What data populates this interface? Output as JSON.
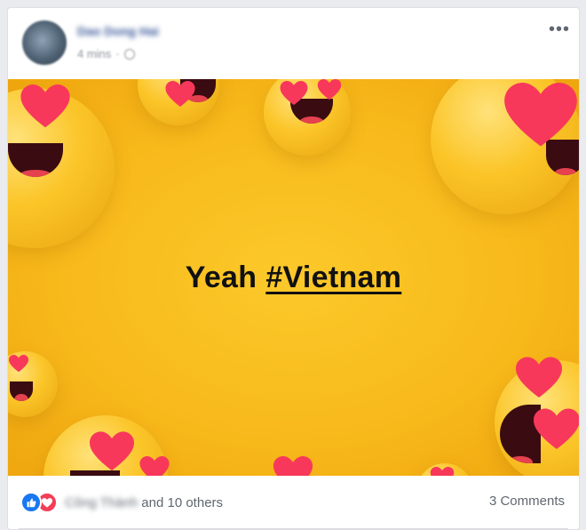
{
  "post": {
    "author_name": "Dao Dong Hai",
    "timestamp": "4 mins",
    "separator": "·",
    "audience_icon": "globe-icon",
    "more_label": "•••",
    "status_text": "Yeah",
    "hashtag": "#Vietnam",
    "background_theme": "heart-eyes-emoji",
    "background_color": "#f7b81a"
  },
  "footer": {
    "reaction_icons": [
      "like-icon",
      "love-icon"
    ],
    "reactor_name": "Công Thành",
    "others_text": "and 10 others",
    "comments_text": "3 Comments"
  },
  "colors": {
    "like": "#1877f2",
    "love": "#f33e58",
    "meta_text": "#90949c"
  }
}
